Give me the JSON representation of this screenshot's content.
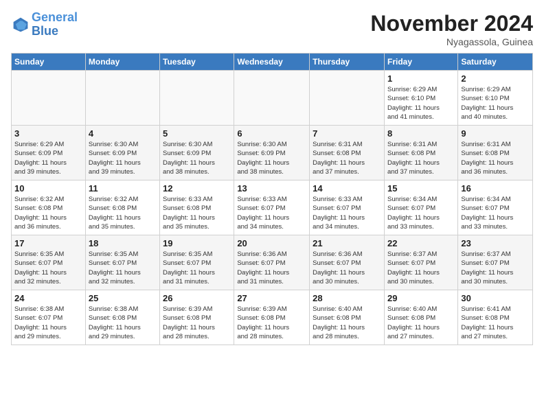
{
  "logo": {
    "line1": "General",
    "line2": "Blue"
  },
  "title": "November 2024",
  "location": "Nyagassola, Guinea",
  "days_of_week": [
    "Sunday",
    "Monday",
    "Tuesday",
    "Wednesday",
    "Thursday",
    "Friday",
    "Saturday"
  ],
  "weeks": [
    [
      {
        "day": "",
        "details": ""
      },
      {
        "day": "",
        "details": ""
      },
      {
        "day": "",
        "details": ""
      },
      {
        "day": "",
        "details": ""
      },
      {
        "day": "",
        "details": ""
      },
      {
        "day": "1",
        "details": "Sunrise: 6:29 AM\nSunset: 6:10 PM\nDaylight: 11 hours\nand 41 minutes."
      },
      {
        "day": "2",
        "details": "Sunrise: 6:29 AM\nSunset: 6:10 PM\nDaylight: 11 hours\nand 40 minutes."
      }
    ],
    [
      {
        "day": "3",
        "details": "Sunrise: 6:29 AM\nSunset: 6:09 PM\nDaylight: 11 hours\nand 39 minutes."
      },
      {
        "day": "4",
        "details": "Sunrise: 6:30 AM\nSunset: 6:09 PM\nDaylight: 11 hours\nand 39 minutes."
      },
      {
        "day": "5",
        "details": "Sunrise: 6:30 AM\nSunset: 6:09 PM\nDaylight: 11 hours\nand 38 minutes."
      },
      {
        "day": "6",
        "details": "Sunrise: 6:30 AM\nSunset: 6:09 PM\nDaylight: 11 hours\nand 38 minutes."
      },
      {
        "day": "7",
        "details": "Sunrise: 6:31 AM\nSunset: 6:08 PM\nDaylight: 11 hours\nand 37 minutes."
      },
      {
        "day": "8",
        "details": "Sunrise: 6:31 AM\nSunset: 6:08 PM\nDaylight: 11 hours\nand 37 minutes."
      },
      {
        "day": "9",
        "details": "Sunrise: 6:31 AM\nSunset: 6:08 PM\nDaylight: 11 hours\nand 36 minutes."
      }
    ],
    [
      {
        "day": "10",
        "details": "Sunrise: 6:32 AM\nSunset: 6:08 PM\nDaylight: 11 hours\nand 36 minutes."
      },
      {
        "day": "11",
        "details": "Sunrise: 6:32 AM\nSunset: 6:08 PM\nDaylight: 11 hours\nand 35 minutes."
      },
      {
        "day": "12",
        "details": "Sunrise: 6:33 AM\nSunset: 6:08 PM\nDaylight: 11 hours\nand 35 minutes."
      },
      {
        "day": "13",
        "details": "Sunrise: 6:33 AM\nSunset: 6:07 PM\nDaylight: 11 hours\nand 34 minutes."
      },
      {
        "day": "14",
        "details": "Sunrise: 6:33 AM\nSunset: 6:07 PM\nDaylight: 11 hours\nand 34 minutes."
      },
      {
        "day": "15",
        "details": "Sunrise: 6:34 AM\nSunset: 6:07 PM\nDaylight: 11 hours\nand 33 minutes."
      },
      {
        "day": "16",
        "details": "Sunrise: 6:34 AM\nSunset: 6:07 PM\nDaylight: 11 hours\nand 33 minutes."
      }
    ],
    [
      {
        "day": "17",
        "details": "Sunrise: 6:35 AM\nSunset: 6:07 PM\nDaylight: 11 hours\nand 32 minutes."
      },
      {
        "day": "18",
        "details": "Sunrise: 6:35 AM\nSunset: 6:07 PM\nDaylight: 11 hours\nand 32 minutes."
      },
      {
        "day": "19",
        "details": "Sunrise: 6:35 AM\nSunset: 6:07 PM\nDaylight: 11 hours\nand 31 minutes."
      },
      {
        "day": "20",
        "details": "Sunrise: 6:36 AM\nSunset: 6:07 PM\nDaylight: 11 hours\nand 31 minutes."
      },
      {
        "day": "21",
        "details": "Sunrise: 6:36 AM\nSunset: 6:07 PM\nDaylight: 11 hours\nand 30 minutes."
      },
      {
        "day": "22",
        "details": "Sunrise: 6:37 AM\nSunset: 6:07 PM\nDaylight: 11 hours\nand 30 minutes."
      },
      {
        "day": "23",
        "details": "Sunrise: 6:37 AM\nSunset: 6:07 PM\nDaylight: 11 hours\nand 30 minutes."
      }
    ],
    [
      {
        "day": "24",
        "details": "Sunrise: 6:38 AM\nSunset: 6:07 PM\nDaylight: 11 hours\nand 29 minutes."
      },
      {
        "day": "25",
        "details": "Sunrise: 6:38 AM\nSunset: 6:08 PM\nDaylight: 11 hours\nand 29 minutes."
      },
      {
        "day": "26",
        "details": "Sunrise: 6:39 AM\nSunset: 6:08 PM\nDaylight: 11 hours\nand 28 minutes."
      },
      {
        "day": "27",
        "details": "Sunrise: 6:39 AM\nSunset: 6:08 PM\nDaylight: 11 hours\nand 28 minutes."
      },
      {
        "day": "28",
        "details": "Sunrise: 6:40 AM\nSunset: 6:08 PM\nDaylight: 11 hours\nand 28 minutes."
      },
      {
        "day": "29",
        "details": "Sunrise: 6:40 AM\nSunset: 6:08 PM\nDaylight: 11 hours\nand 27 minutes."
      },
      {
        "day": "30",
        "details": "Sunrise: 6:41 AM\nSunset: 6:08 PM\nDaylight: 11 hours\nand 27 minutes."
      }
    ]
  ]
}
